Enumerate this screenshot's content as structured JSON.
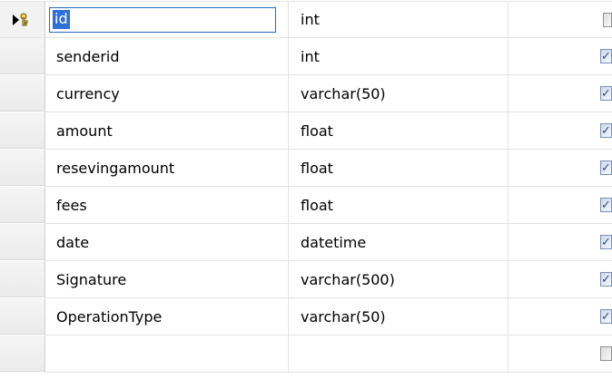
{
  "table": {
    "rows": [
      {
        "name": "id",
        "type": "int",
        "allow_nulls": false,
        "primary_key": true,
        "selected": true
      },
      {
        "name": "senderid",
        "type": "int",
        "allow_nulls": true
      },
      {
        "name": "currency",
        "type": "varchar(50)",
        "allow_nulls": true
      },
      {
        "name": "amount",
        "type": "float",
        "allow_nulls": true
      },
      {
        "name": "resevingamount",
        "type": "float",
        "allow_nulls": true
      },
      {
        "name": "fees",
        "type": "float",
        "allow_nulls": true
      },
      {
        "name": "date",
        "type": "datetime",
        "allow_nulls": true
      },
      {
        "name": "Signature",
        "type": "varchar(500)",
        "allow_nulls": true
      },
      {
        "name": "OperationType",
        "type": "varchar(50)",
        "allow_nulls": true
      },
      {
        "name": "",
        "type": "",
        "allow_nulls": false
      }
    ]
  },
  "icons": {
    "row_selector_arrow": "right-arrow-icon",
    "primary_key": "key-icon",
    "checkbox_checked": "checkbox-checked-icon",
    "checkbox_unchecked": "checkbox-unchecked-icon"
  },
  "colors": {
    "selection_blue": "#2e6fd8",
    "selection_border": "#2868c0",
    "grid_line": "#e4e4e4",
    "row_header": "#f2f2f2"
  }
}
